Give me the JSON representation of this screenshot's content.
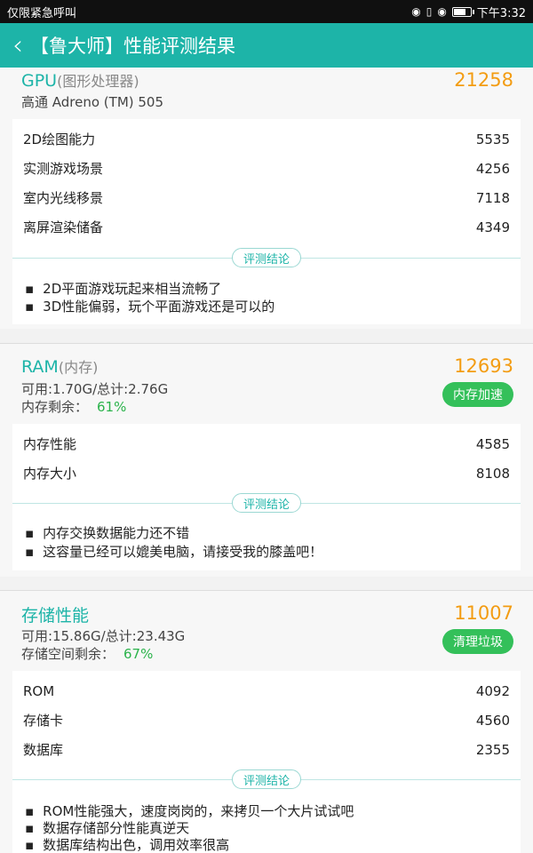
{
  "status": {
    "left_text": "仅限紧急呼叫",
    "time": "下午3:32",
    "battery_level": 0.7,
    "icons": [
      "incognito-icon",
      "vibrate-icon",
      "wifi-icon",
      "battery-icon"
    ]
  },
  "appbar": {
    "title": "【鲁大师】性能评测结果",
    "back_icon": "chevron-left-icon"
  },
  "gpu": {
    "title": "GPU",
    "title_sub": "(图形处理器)",
    "model": "高通 Adreno (TM) 505",
    "score": "21258",
    "metrics": [
      {
        "name": "2D绘图能力",
        "value": "5535"
      },
      {
        "name": "实测游戏场景",
        "value": "4256"
      },
      {
        "name": "室内光线移景",
        "value": "7118"
      },
      {
        "name": "离屏渲染储备",
        "value": "4349"
      }
    ],
    "conclusion_label": "评测结论",
    "conclusions": [
      "2D平面游戏玩起来相当流畅了",
      "3D性能偏弱，玩个平面游戏还是可以的"
    ]
  },
  "ram": {
    "title": "RAM",
    "title_sub": "(内存)",
    "capacity": "可用:1.70G/总计:2.76G",
    "remain_label": "内存剩余：",
    "remain_value": "61%",
    "score": "12693",
    "button": "内存加速",
    "metrics": [
      {
        "name": "内存性能",
        "value": "4585"
      },
      {
        "name": "内存大小",
        "value": "8108"
      }
    ],
    "conclusion_label": "评测结论",
    "conclusions": [
      "内存交换数据能力还不错",
      "这容量已经可以媲美电脑，请接受我的膝盖吧！"
    ]
  },
  "storage": {
    "title": "存储性能",
    "capacity": "可用:15.86G/总计:23.43G",
    "remain_label": "存储空间剩余：",
    "remain_value": "67%",
    "score": "11007",
    "button": "清理垃圾",
    "metrics": [
      {
        "name": "ROM",
        "value": "4092"
      },
      {
        "name": "存储卡",
        "value": "4560"
      },
      {
        "name": "数据库",
        "value": "2355"
      }
    ],
    "conclusion_label": "评测结论",
    "conclusions": [
      "ROM性能强大，速度岗岗的，来拷贝一个大片试试吧",
      "数据存储部分性能真逆天",
      "数据库结构出色，调用效率很高"
    ]
  }
}
